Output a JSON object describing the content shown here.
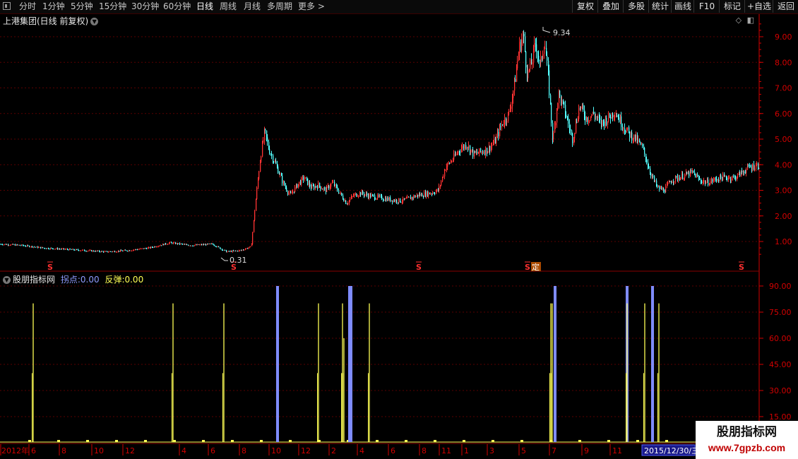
{
  "toolbar": {
    "periods": [
      "分时",
      "1分钟",
      "5分钟",
      "15分钟",
      "30分钟",
      "60分钟",
      "日线",
      "周线",
      "月线",
      "多周期",
      "更多 >"
    ],
    "active_period": "日线",
    "buttons": [
      "复权",
      "叠加",
      "多股",
      "统计",
      "画线",
      "F10",
      "标记",
      "+自选",
      "返回"
    ]
  },
  "main_chart": {
    "title": "上港集团(日线 前复权)",
    "y_ticks": [
      "9.00",
      "8.00",
      "7.00",
      "6.00",
      "5.00",
      "4.00",
      "3.00",
      "2.00",
      "1.00"
    ],
    "high_label": "9.34",
    "low_label": "0.31",
    "markers": [
      "S",
      "S",
      "S",
      "S",
      "S"
    ],
    "marker_extra": "定"
  },
  "indicator": {
    "name": "股朋指标网",
    "label1": "拐点:",
    "value1": "0.00",
    "label2": "反弹:",
    "value2": "0.00",
    "y_ticks": [
      "90.00",
      "75.00",
      "60.00",
      "45.00",
      "30.00",
      "15.00"
    ]
  },
  "x_axis": {
    "labels": [
      "2012年",
      "6",
      "8",
      "10",
      "12",
      "4",
      "6",
      "8",
      "10",
      "12",
      "2",
      "4",
      "6",
      "8",
      "11",
      "1",
      "3",
      "5",
      "7",
      "9",
      "11"
    ],
    "current_date": "2015/12/30/三"
  },
  "watermark": {
    "line1": "股朋指标网",
    "line2": "www.7gpzb.com"
  },
  "colors": {
    "up": "#ff3333",
    "down": "#54ffff",
    "grid": "#5a0000",
    "axis": "#d40000",
    "yellow": "#ffff55",
    "blue": "#7f8cff"
  },
  "chart_data": [
    {
      "type": "line",
      "title": "上港集团(日线 前复权)",
      "x": [
        0,
        30,
        60,
        90,
        120,
        150,
        180,
        210,
        240,
        270,
        300,
        320,
        340,
        355,
        362,
        368,
        374,
        380,
        390,
        400,
        410,
        420,
        430,
        440,
        450,
        460,
        470,
        480,
        490,
        500,
        510,
        520,
        530,
        540,
        550,
        560,
        570,
        580,
        590,
        600,
        610,
        620,
        630,
        640,
        650,
        660,
        670,
        680,
        690,
        700,
        710,
        720,
        728,
        734,
        740,
        746,
        752,
        758,
        764,
        770,
        776,
        782,
        790,
        800,
        810,
        820,
        830,
        840,
        850,
        860,
        870,
        880,
        890,
        900,
        910,
        920,
        930,
        940,
        950,
        960,
        970,
        980,
        990,
        1000,
        1010,
        1020,
        1030,
        1040,
        1050,
        1060,
        1075
      ],
      "y": [
        0.9,
        0.85,
        0.75,
        0.7,
        0.65,
        0.6,
        0.65,
        0.75,
        0.95,
        0.85,
        0.9,
        0.6,
        0.65,
        0.8,
        2.8,
        4.3,
        5.3,
        4.6,
        4.0,
        3.3,
        2.8,
        3.2,
        3.5,
        3.1,
        3.2,
        3.0,
        3.3,
        2.9,
        2.5,
        2.8,
        2.9,
        2.8,
        2.75,
        2.7,
        2.65,
        2.6,
        2.6,
        2.7,
        2.8,
        2.85,
        2.9,
        3.0,
        3.9,
        4.2,
        4.6,
        4.8,
        4.4,
        4.5,
        4.6,
        4.9,
        5.6,
        6.0,
        7.2,
        8.5,
        9.1,
        7.5,
        8.0,
        8.8,
        7.8,
        8.9,
        7.3,
        4.9,
        6.8,
        6.0,
        5.0,
        6.3,
        5.8,
        6.0,
        5.6,
        5.8,
        6.1,
        5.6,
        5.2,
        5.0,
        4.6,
        3.7,
        3.1,
        3.0,
        3.4,
        3.5,
        3.6,
        3.7,
        3.4,
        3.3,
        3.4,
        3.5,
        3.5,
        3.5,
        3.7,
        3.9,
        4.0
      ],
      "ylabel": "",
      "ylim": [
        0.3,
        9.6
      ]
    },
    {
      "type": "bar",
      "title": "股朋指标网",
      "series": [
        {
          "name": "拐点",
          "x": [
            393,
            495,
            497,
            786,
            888,
            924
          ],
          "values": [
            90,
            90,
            90,
            90,
            90,
            90
          ]
        },
        {
          "name": "反弹",
          "x": [
            47,
            245,
            317,
            451,
            485,
            487,
            523,
            780,
            782,
            888,
            913,
            933
          ],
          "values": [
            80,
            80,
            80,
            80,
            80,
            60,
            80,
            80,
            80,
            80,
            80,
            80
          ]
        }
      ],
      "ylim": [
        0,
        95
      ]
    }
  ]
}
